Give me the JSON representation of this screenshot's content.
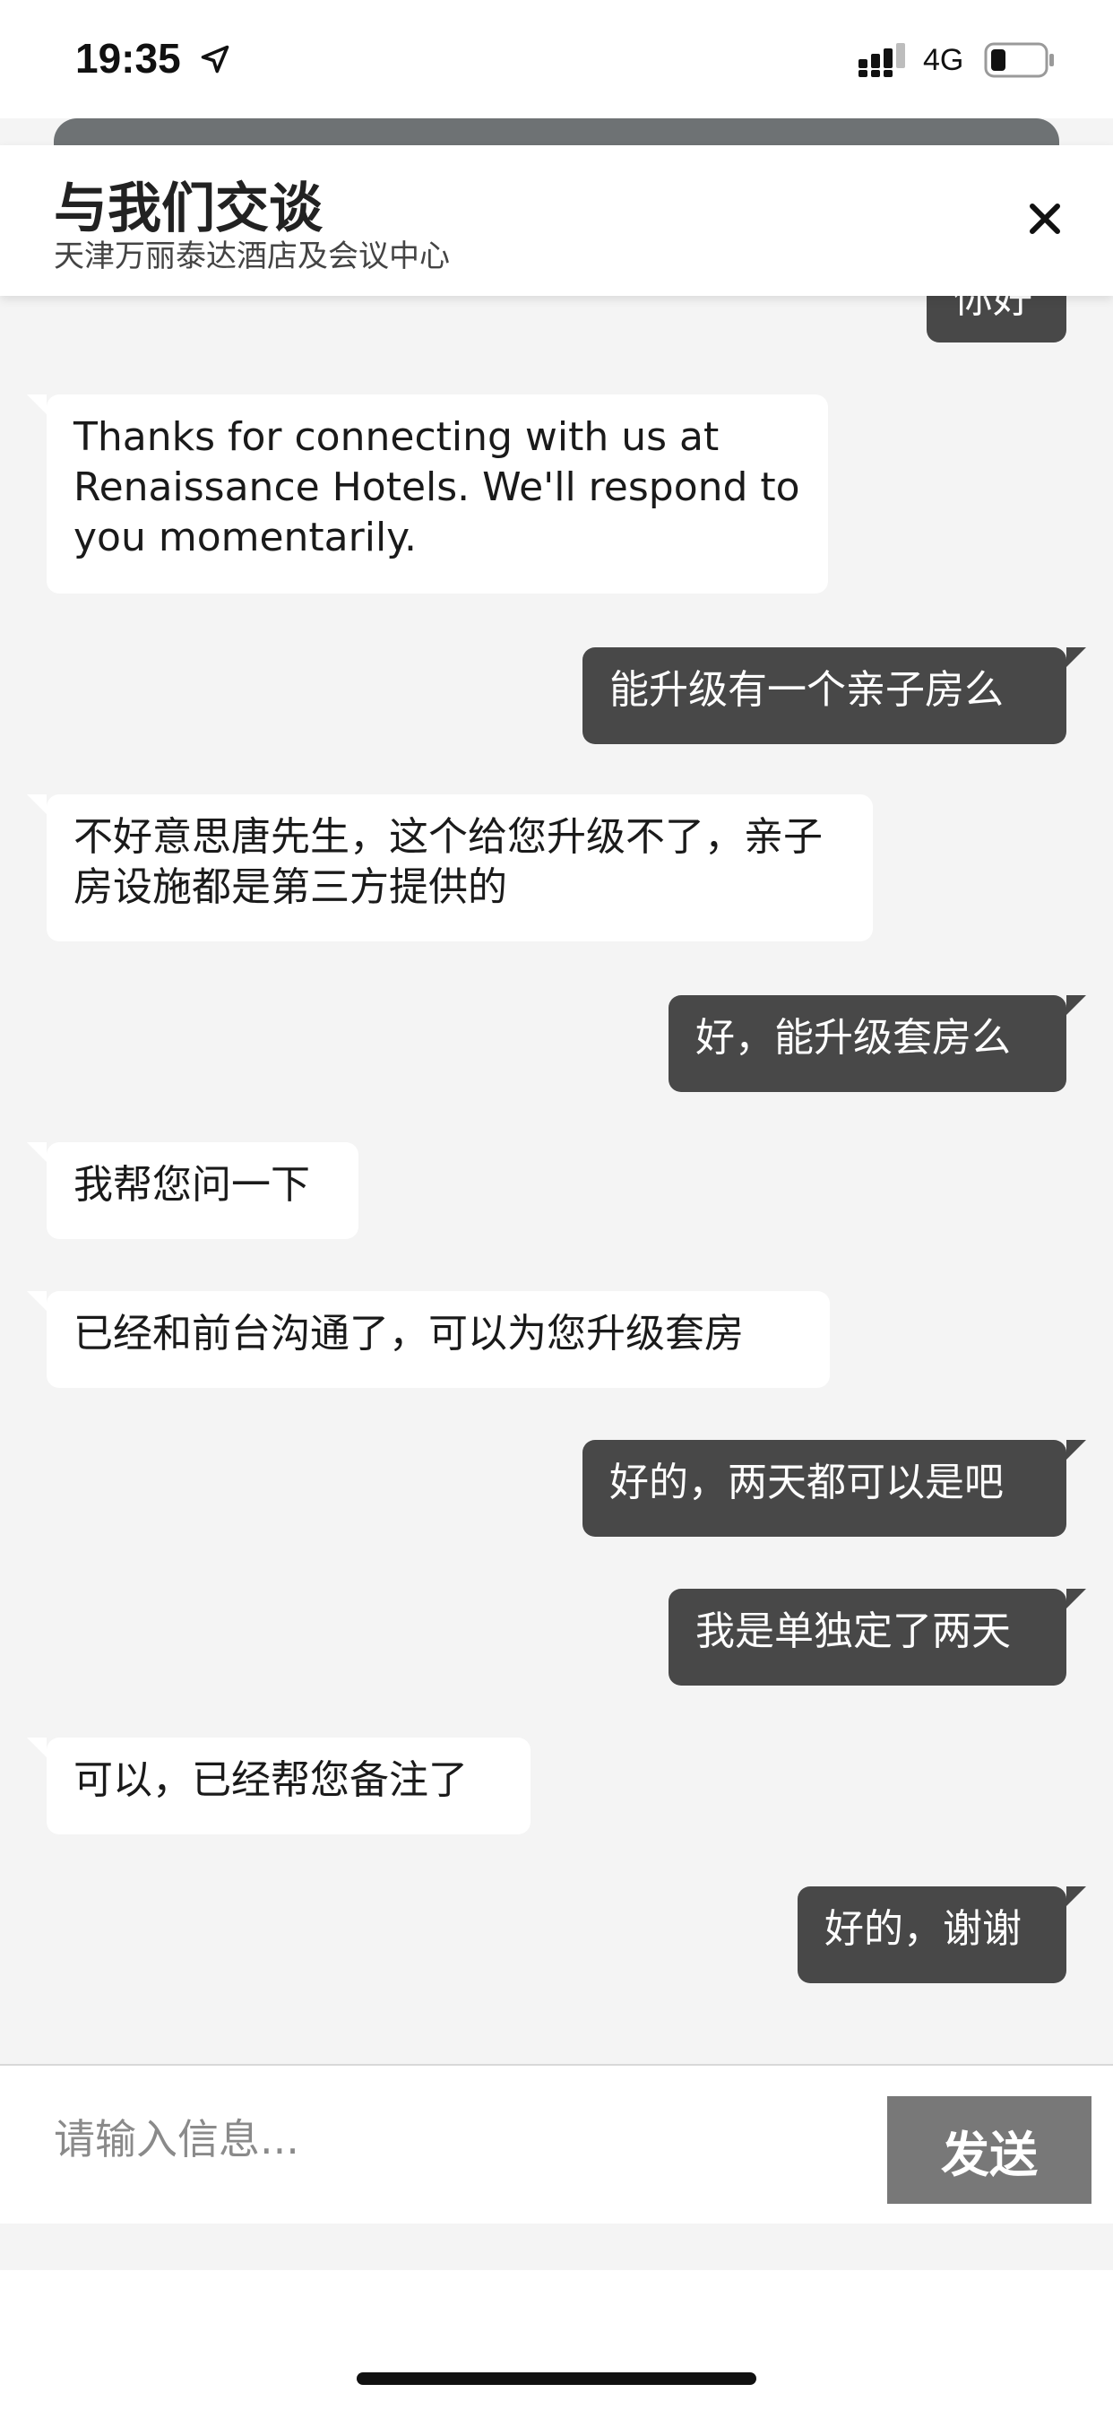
{
  "status_bar": {
    "time": "19:35",
    "network": "4G",
    "icons": [
      "location-arrow-icon",
      "signal-bars-icon",
      "battery-icon"
    ]
  },
  "header": {
    "title": "与我们交谈",
    "subtitle": "天津万丽泰达酒店及会议中心",
    "close_icon": "close-icon"
  },
  "messages": [
    {
      "from": "user",
      "text": "你好"
    },
    {
      "from": "agent",
      "text": "Thanks for connecting with us at Renaissance Hotels. We'll respond to you momentarily."
    },
    {
      "from": "user",
      "text": "能升级有一个亲子房么"
    },
    {
      "from": "agent",
      "text": "不好意思唐先生，这个给您升级不了，亲子房设施都是第三方提供的"
    },
    {
      "from": "user",
      "text": "好，能升级套房么"
    },
    {
      "from": "agent",
      "text": "我帮您问一下"
    },
    {
      "from": "agent",
      "text": "已经和前台沟通了，可以为您升级套房"
    },
    {
      "from": "user",
      "text": "好的，两天都可以是吧"
    },
    {
      "from": "user",
      "text": "我是单独定了两天"
    },
    {
      "from": "agent",
      "text": "可以，已经帮您备注了"
    },
    {
      "from": "user",
      "text": "好的，谢谢"
    }
  ],
  "composer": {
    "placeholder": "请输入信息...",
    "send_label": "发送"
  },
  "colors": {
    "outgoing_bubble": "#484848",
    "incoming_bubble": "#ffffff",
    "chat_background": "#f4f4f4",
    "send_button": "#787878"
  }
}
